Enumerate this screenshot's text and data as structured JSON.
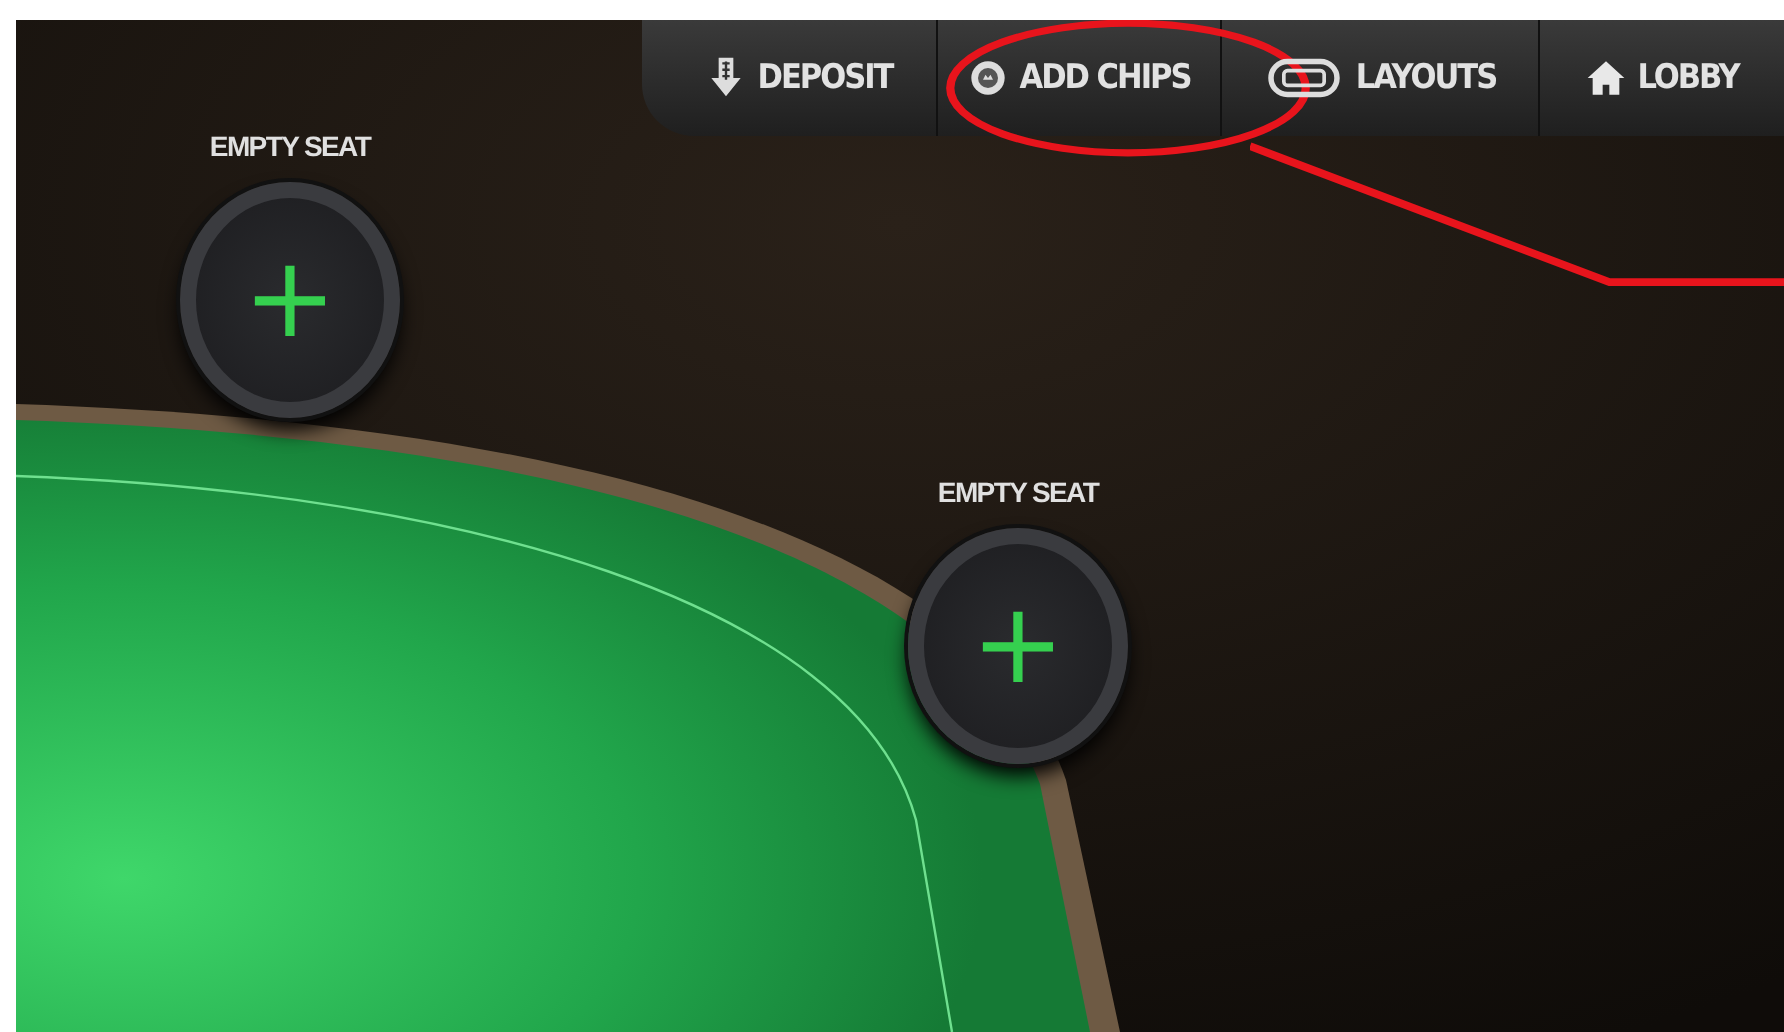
{
  "menu": [
    {
      "label": "DEPOSIT",
      "highlighted": false
    },
    {
      "label": "ADD CHIPS",
      "highlighted": true
    },
    {
      "label": "LAYOUTS",
      "highlighted": false
    },
    {
      "label": "LOBBY",
      "highlighted": false
    }
  ],
  "seats": [
    {
      "label": "EMPTY SEAT",
      "button": "+"
    },
    {
      "label": "EMPTY SEAT",
      "button": "+"
    }
  ]
}
